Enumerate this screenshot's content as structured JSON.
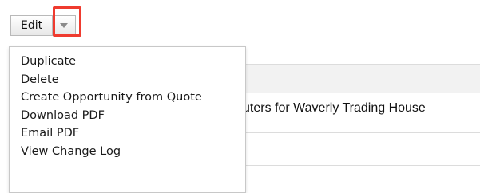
{
  "toolbar": {
    "edit_label": "Edit",
    "caret_icon": "chevron-down-icon",
    "highlight_color": "#ef3b2f"
  },
  "menu": {
    "items": [
      {
        "label": "Duplicate"
      },
      {
        "label": "Delete"
      },
      {
        "label": "Create Opportunity from Quote"
      },
      {
        "label": "Download PDF"
      },
      {
        "label": "Email PDF"
      },
      {
        "label": "View Change Log"
      }
    ]
  },
  "record": {
    "name_fragment": "uters for Waverly Trading House"
  }
}
